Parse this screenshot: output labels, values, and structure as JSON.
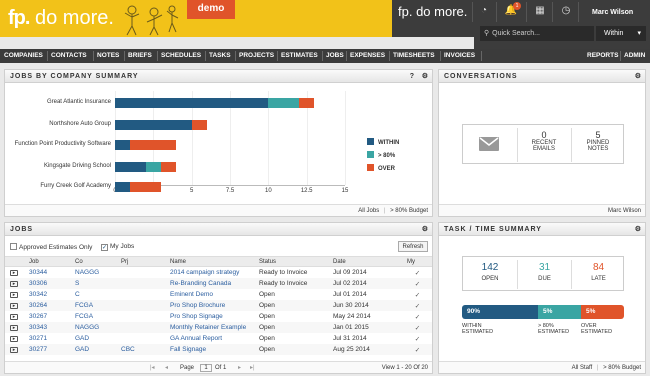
{
  "header": {
    "logo_main": "fp.",
    "logo_suffix": " do more.",
    "demo_label": "demo",
    "logo2_main": "fp.",
    "logo2_suffix": " do more.",
    "notif_count": "1",
    "user": "Marc Wilson",
    "search_placeholder": "Quick Search...",
    "within": "Within",
    "within_caret": "▾"
  },
  "nav": {
    "items": [
      "COMPANIES",
      "CONTACTS",
      "NOTES",
      "BRIEFS",
      "SCHEDULES",
      "TASKS",
      "PROJECTS",
      "ESTIMATES",
      "JOBS",
      "EXPENSES",
      "TIMESHEETS",
      "INVOICES"
    ],
    "right": [
      "REPORTS",
      "ADMIN"
    ]
  },
  "jobs_summary": {
    "title": "JOBS BY COMPANY SUMMARY",
    "help": "?",
    "settings": "⚙",
    "footer_left": "All Jobs",
    "footer_right": "> 80% Budget"
  },
  "chart_data": {
    "type": "bar",
    "orientation": "horizontal",
    "stacked": true,
    "categories": [
      "Great Atlantic Insurance",
      "Northshore Auto Group",
      "Function Point Productivity Software",
      "Kingsgate Driving School",
      "Furry Creek Golf Academy"
    ],
    "series": [
      {
        "name": "WITHIN",
        "color": "#225a82",
        "values": [
          10,
          5,
          1,
          2,
          1
        ]
      },
      {
        "name": "> 80%",
        "color": "#3aa5a3",
        "values": [
          2,
          0,
          0,
          1,
          0
        ]
      },
      {
        "name": "OVER",
        "color": "#e0542a",
        "values": [
          1,
          1,
          3,
          1,
          2
        ]
      }
    ],
    "xticks": [
      "0",
      "2.5",
      "5",
      "7.5",
      "10",
      "12.5",
      "15"
    ],
    "xlim": [
      0,
      15
    ],
    "legend": "right",
    "grid": true
  },
  "conversations": {
    "title": "CONVERSATIONS",
    "settings": "⚙",
    "stat1_value": "0",
    "stat1_label": "RECENT EMAILS",
    "stat2_value": "5",
    "stat2_label": "PINNED NOTES",
    "footer": "Marc Wilson"
  },
  "jobs": {
    "title": "JOBS",
    "settings": "⚙",
    "approved_label": "Approved Estimates Only",
    "myjobs_label": "My Jobs",
    "refresh": "Refresh",
    "columns": [
      "",
      "Job",
      "Co",
      "Prj",
      "Name",
      "Status",
      "Date",
      "My"
    ],
    "rows": [
      [
        "30344",
        "NAGGG",
        "",
        "2014 campaign strategy",
        "Ready to Invoice",
        "Jul 09 2014"
      ],
      [
        "30306",
        "S",
        "",
        "Re-Branding Canada",
        "Ready to Invoice",
        "Jul 02 2014"
      ],
      [
        "30342",
        "C",
        "",
        "Eminent Demo",
        "Open",
        "Jul 01 2014"
      ],
      [
        "30264",
        "FCGA",
        "",
        "Pro Shop Brochure",
        "Open",
        "Jun 30 2014"
      ],
      [
        "30267",
        "FCGA",
        "",
        "Pro Shop Signage",
        "Open",
        "May 24 2014"
      ],
      [
        "30343",
        "NAGGG",
        "",
        "Monthly Retainer Example",
        "Open",
        "Jan 01 2015"
      ],
      [
        "30271",
        "GAD",
        "",
        "GA Annual Report",
        "Open",
        "Jul 31 2014"
      ],
      [
        "30277",
        "GAD",
        "CBC",
        "Fall Signage",
        "Open",
        "Aug 25 2014"
      ]
    ],
    "pager_first": "|◂",
    "pager_prev": "◂",
    "page_label": "Page",
    "page_value": "1",
    "page_of": "Of 1",
    "pager_next": "▸",
    "pager_last": "▸|",
    "view_info": "View 1 - 20 Of 20"
  },
  "task_summary": {
    "title": "TASK / TIME SUMMARY",
    "settings": "⚙",
    "open_value": "142",
    "open_label": "OPEN",
    "due_value": "31",
    "due_label": "DUE",
    "late_value": "84",
    "late_label": "LATE",
    "colors": {
      "open": "#225a82",
      "due": "#3aa5a3",
      "late": "#e0542a"
    },
    "bar": [
      {
        "label": "90%",
        "pct": 90,
        "caption": "WITHIN ESTIMATED"
      },
      {
        "label": "5%",
        "pct": 5,
        "caption": "> 80% ESTIMATED"
      },
      {
        "label": "5%",
        "pct": 5,
        "caption": "OVER ESTIMATED"
      }
    ],
    "footer_left": "All Staff",
    "footer_right": "> 80% Budget"
  }
}
